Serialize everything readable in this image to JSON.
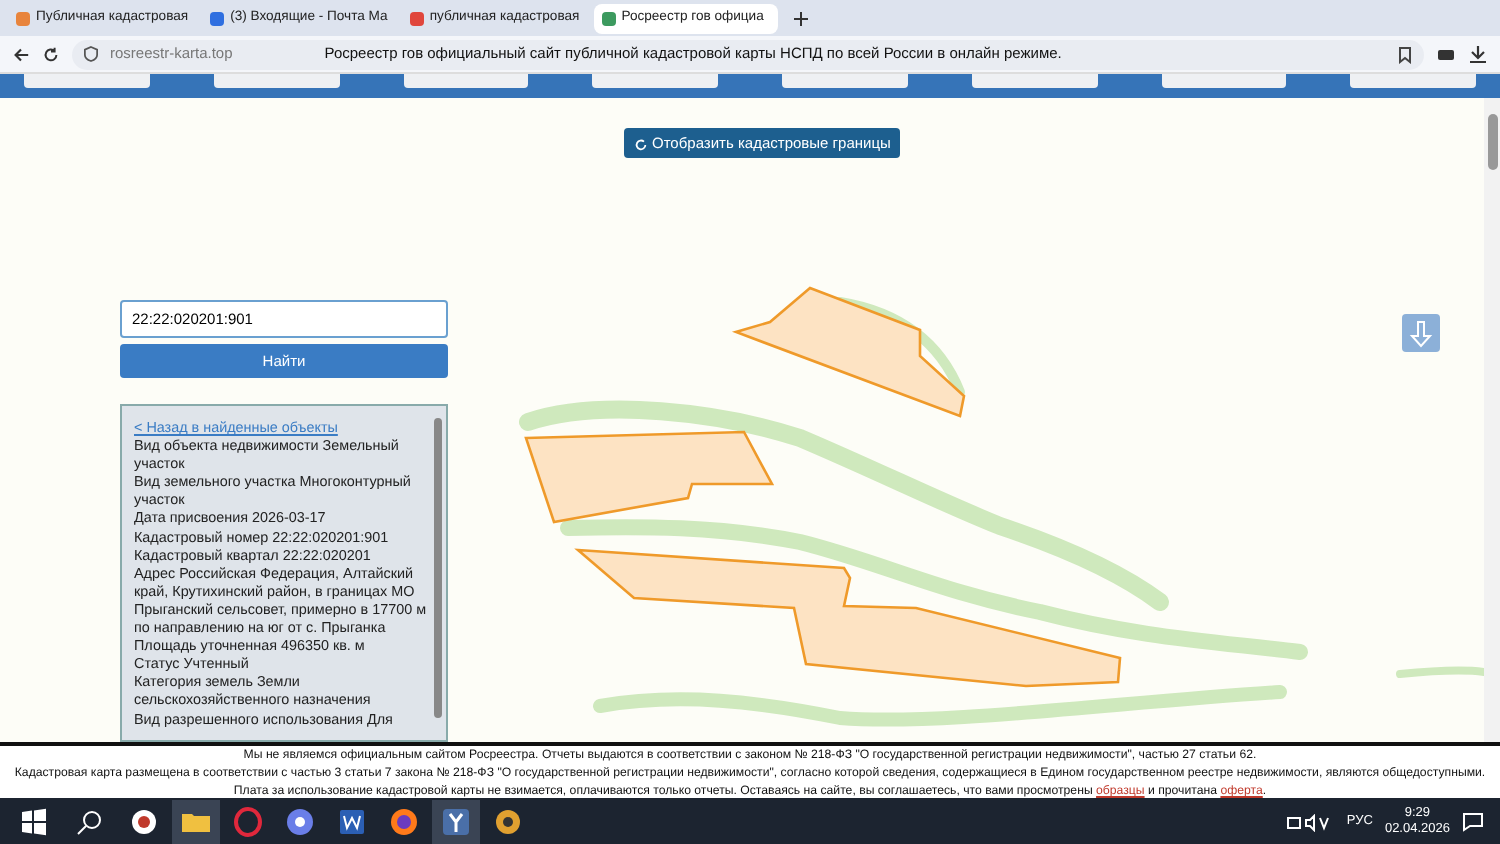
{
  "browser": {
    "tabs": [
      {
        "title": "Публичная кадастровая",
        "selected": false,
        "color": "#e8843c"
      },
      {
        "title": "(3) Входящие - Почта Ма",
        "selected": false,
        "color": "#2f6fe0"
      },
      {
        "title": "публичная кадастровая",
        "selected": false,
        "color": "#e0463c"
      },
      {
        "title": "Росреестр гов официа",
        "selected": true,
        "color": "#3c9a5f"
      }
    ],
    "url": "rosreestr-karta.top",
    "page_title": "Росреестр гов официальный сайт публичной кадастровой карты НСПД по всей России в онлайн режиме."
  },
  "map": {
    "show_borders_button": "Отобразить кадастровые границы"
  },
  "search": {
    "value": "22:22:020201:901",
    "button": "Найти"
  },
  "info_panel": {
    "back_link": "< Назад в найденные объекты",
    "lines": [
      "Вид объекта недвижимости Земельный участок",
      "Вид земельного участка Многоконтурный участок",
      "Дата присвоения 2026-03-17",
      "Кадастровый номер 22:22:020201:901",
      "Кадастровый квартал 22:22:020201",
      "Адрес Российская Федерация, Алтайский край, Крутихинский район, в границах МО Прыганский сельсовет, примерно в 17700 м по направлению на юг от с. Прыганка",
      "Площадь уточненная 496350 кв. м",
      "Статус Учтенный",
      "Категория земель Земли сельскохозяйственного назначения",
      "Вид разрешенного использования Для"
    ]
  },
  "footer": {
    "line_1": "Мы не являемся официальным сайтом Росреестра. Отчеты выдаются в соответствии с законом № 218-ФЗ \"О государственной регистрации недвижимости\", частью 27 статьи 62.",
    "line_2": "Кадастровая карта размещена в соответствии с частью 3 статьи 7 закона № 218-ФЗ \"О государственной регистрации недвижимости\", согласно которой сведения, содержащиеся в Едином государственном реестре недвижимости, являются общедоступными.",
    "line_3": [
      {
        "kind": "text",
        "text": "Плата за использование кадастровой карты не взимается, оплачиваются только отчеты. Оставаясь на сайте, вы соглашаетесь, что вами просмотрены"
      },
      {
        "kind": "link",
        "text": "образцы"
      },
      {
        "kind": "text",
        "text": "и прочитана"
      },
      {
        "kind": "link",
        "text": "оферта"
      },
      {
        "kind": "text",
        "text": "."
      }
    ]
  },
  "taskbar": {
    "apps": [
      {
        "kind": "ccleaner",
        "selected": false
      },
      {
        "kind": "folder",
        "selected": true
      },
      {
        "kind": "opera",
        "selected": false
      },
      {
        "kind": "disk",
        "selected": false
      },
      {
        "kind": "word",
        "selected": false
      },
      {
        "kind": "firefox",
        "selected": false
      },
      {
        "kind": "yandex",
        "selected": true
      },
      {
        "kind": "game",
        "selected": false
      }
    ],
    "language": "РУС",
    "time": "9:29",
    "date": "02.04.2026"
  }
}
